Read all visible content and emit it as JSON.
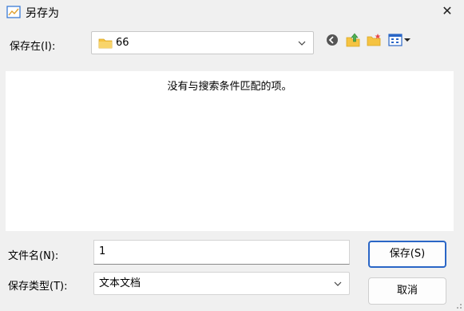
{
  "window": {
    "title": "另存为",
    "close_label": "✕"
  },
  "location": {
    "label": "保存在(I):",
    "current_folder": "66"
  },
  "file_list": {
    "empty_message": "没有与搜索条件匹配的项。"
  },
  "filename": {
    "label": "文件名(N):",
    "value": "1"
  },
  "filetype": {
    "label": "保存类型(T):",
    "value": "文本文档"
  },
  "buttons": {
    "save": "保存(S)",
    "cancel": "取消"
  },
  "colors": {
    "accent": "#2a66c6",
    "folder": "#f5c342",
    "back_icon": "#555555",
    "up_icon": "#4caf50"
  },
  "icons": [
    "app-icon",
    "close-icon",
    "folder-icon",
    "chevron-down-icon",
    "back-icon",
    "up-folder-icon",
    "new-folder-icon",
    "view-menu-icon"
  ]
}
